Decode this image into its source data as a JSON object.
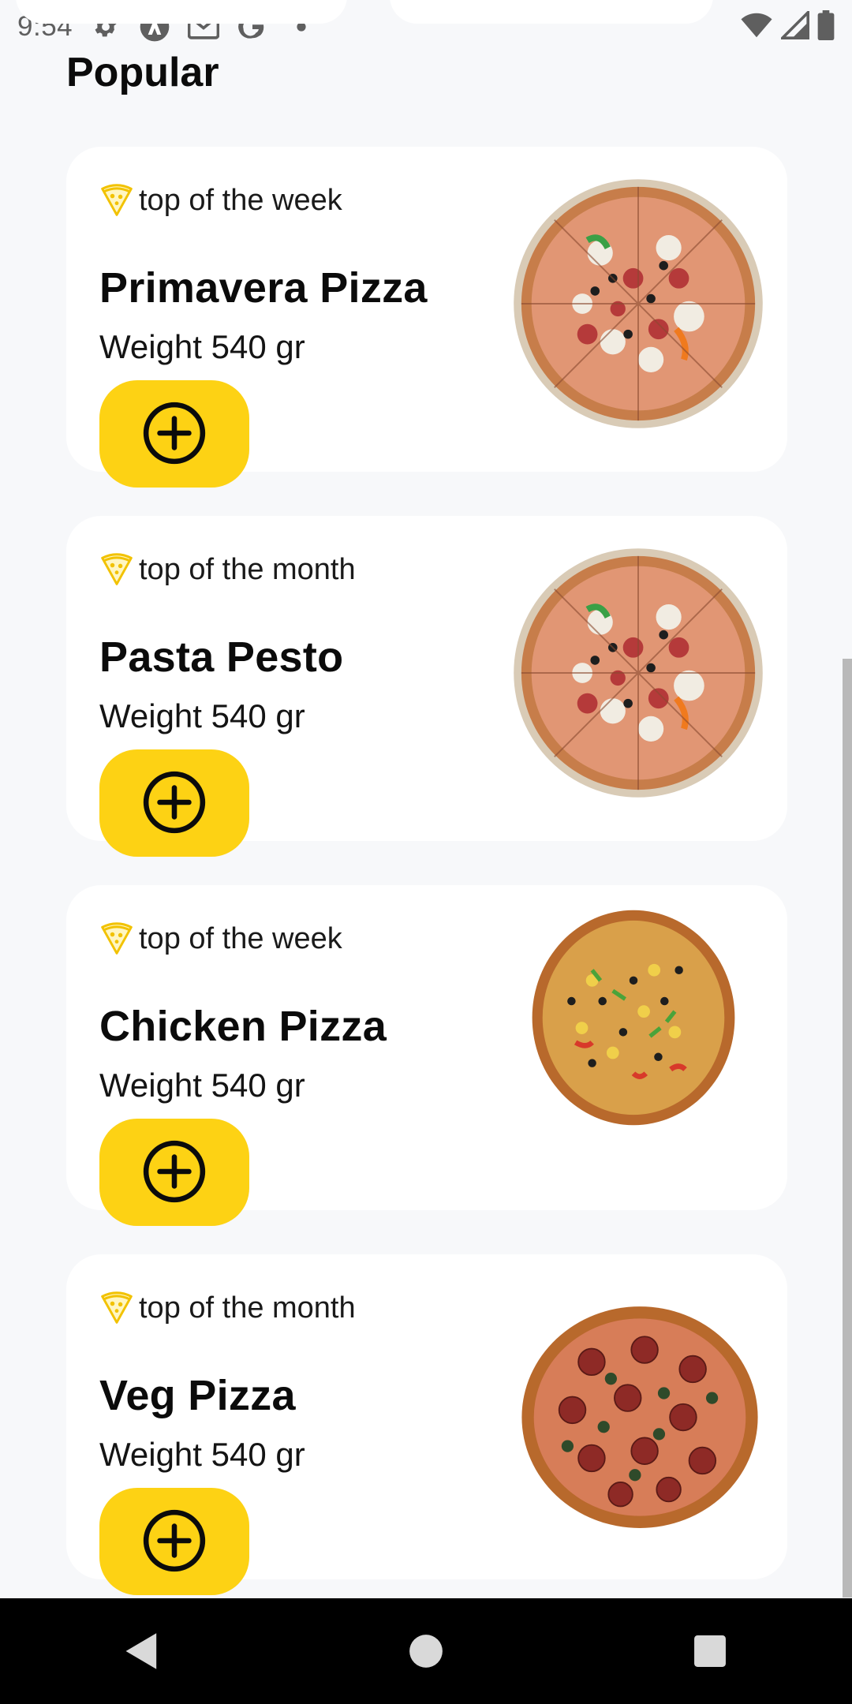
{
  "status_bar": {
    "time": "9:54",
    "icons": [
      "gear-icon",
      "arch-icon",
      "gmail-icon",
      "google-icon",
      "dot-icon"
    ],
    "right_icons": [
      "wifi-icon",
      "signal-icon",
      "battery-icon"
    ]
  },
  "section": {
    "title": "Popular"
  },
  "items": [
    {
      "tag": "top of the week",
      "name": "Primavera Pizza",
      "weight": "Weight 540 gr",
      "add_icon": "plus-circle-icon"
    },
    {
      "tag": "top of the month",
      "name": "Pasta Pesto",
      "weight": "Weight 540 gr",
      "add_icon": "plus-circle-icon"
    },
    {
      "tag": "top of the week",
      "name": "Chicken Pizza",
      "weight": "Weight 540 gr",
      "add_icon": "plus-circle-icon"
    },
    {
      "tag": "top of the month",
      "name": "Veg Pizza",
      "weight": "Weight 540 gr",
      "add_icon": "plus-circle-icon"
    }
  ],
  "nav_bar": {
    "buttons": [
      "back-icon",
      "home-icon",
      "recents-icon"
    ]
  },
  "colors": {
    "accent": "#fdd214",
    "background": "#f7f8fa",
    "card": "#ffffff",
    "nav": "#000000"
  }
}
